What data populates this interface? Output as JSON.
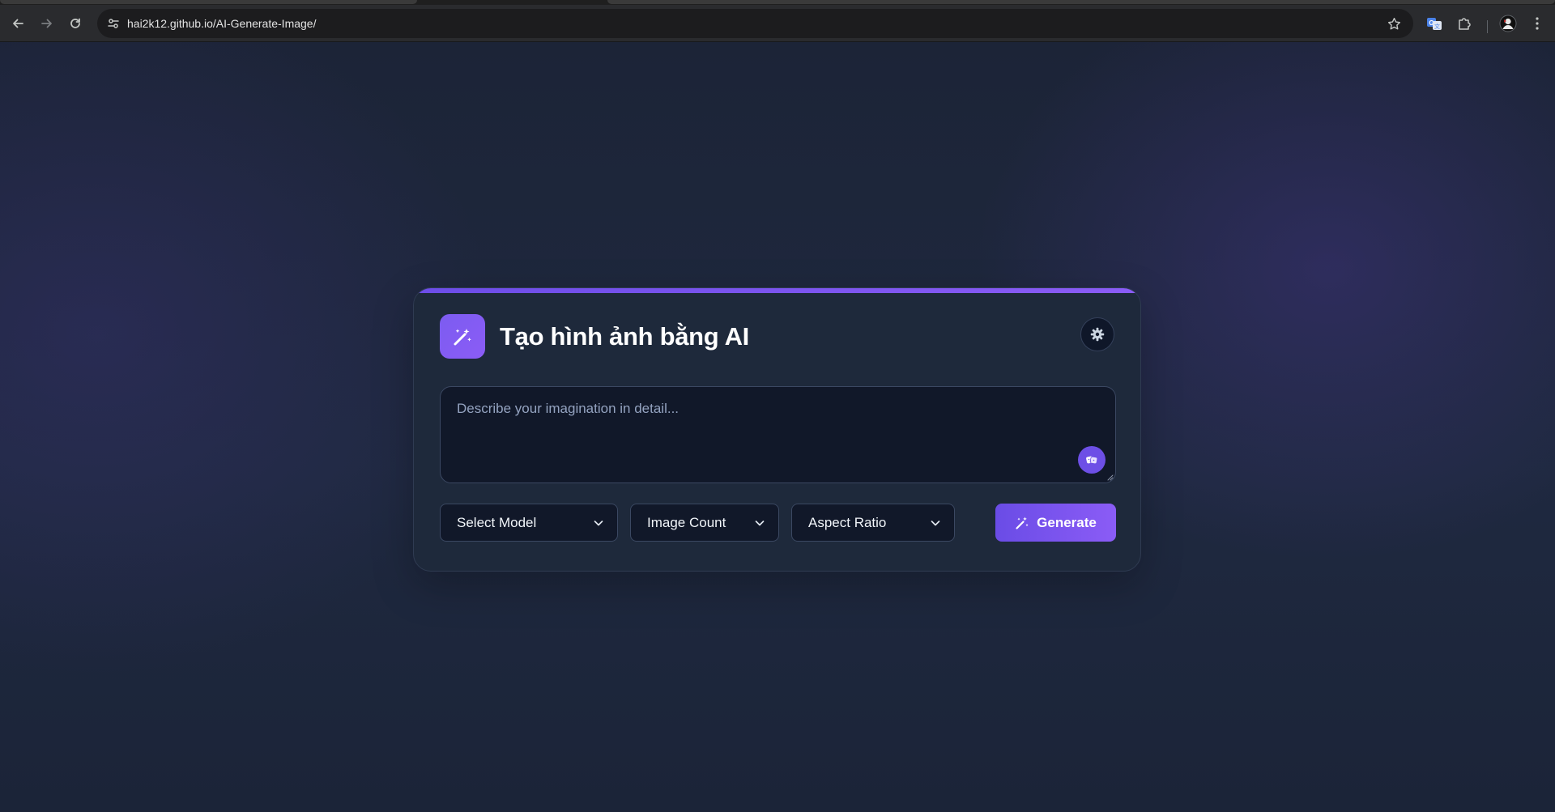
{
  "browser": {
    "url": "hai2k12.github.io/AI-Generate-Image/"
  },
  "app": {
    "title": "Tạo hình ảnh bằng AI",
    "prompt": {
      "value": "",
      "placeholder": "Describe your imagination in detail..."
    },
    "selects": {
      "model_label": "Select Model",
      "count_label": "Image Count",
      "ratio_label": "Aspect Ratio"
    },
    "generate_label": "Generate"
  },
  "colors": {
    "accent": "#8b5cf6",
    "background": "#1d2536",
    "card": "#1e293b",
    "input": "#111829"
  },
  "icons": {
    "back": "arrow-left-icon",
    "forward": "arrow-right-icon",
    "reload": "reload-icon",
    "site_info": "tune-icon",
    "bookmark": "star-icon",
    "translate": "translate-icon",
    "extensions": "puzzle-icon",
    "profile": "avatar-icon",
    "menu": "kebab-menu-icon",
    "logo": "magic-wand-icon",
    "settings": "gear-icon",
    "suggest": "dice-icon",
    "dropdown": "chevron-down-icon",
    "generate": "magic-wand-icon"
  }
}
